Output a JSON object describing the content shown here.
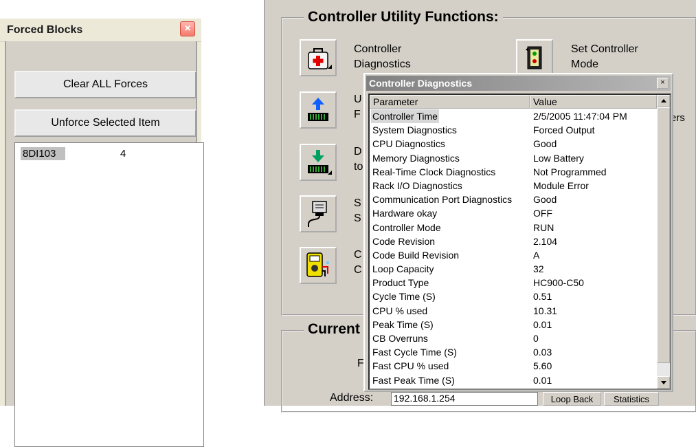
{
  "forced_blocks": {
    "title": "Forced Blocks",
    "close_glyph": "×",
    "clear_all_label": "Clear ALL Forces",
    "unforce_label": "Unforce Selected Item",
    "items": [
      {
        "name": "8DI103",
        "value": "4"
      }
    ]
  },
  "controller_utility": {
    "title": "Controller Utility Functions:",
    "buttons": [
      {
        "icon": "medical-bag-icon",
        "label_line1": "Controller",
        "label_line2": "Diagnostics"
      },
      {
        "icon": "set-mode-icon",
        "label_line1": "Set Controller",
        "label_line2": "Mode"
      },
      {
        "icon": "upload-icon",
        "label_line1": "U",
        "label_line2": "F"
      },
      {
        "icon": "download-icon",
        "label_line1": "D",
        "label_line2": "to"
      },
      {
        "icon": "serial-connection-icon",
        "label_line1": "S",
        "label_line2": "S"
      },
      {
        "icon": "meter-icon",
        "label_line1": "C",
        "label_line2": "C"
      }
    ],
    "partial_text_right": "ers"
  },
  "current_group": {
    "title": "Current",
    "partial_label": "F",
    "address_label": "Address:",
    "address_value": "192.168.1.254",
    "loop_back_label": "Loop Back",
    "statistics_label": "Statistics"
  },
  "diagnostics_dialog": {
    "title": "Controller Diagnostics",
    "close_glyph": "×",
    "columns": [
      "Parameter",
      "Value"
    ],
    "rows": [
      {
        "parameter": "Controller Time",
        "value": "2/5/2005  11:47:04 PM"
      },
      {
        "parameter": "System Diagnostics",
        "value": "Forced Output"
      },
      {
        "parameter": "CPU Diagnostics",
        "value": "Good"
      },
      {
        "parameter": "Memory Diagnostics",
        "value": "Low Battery"
      },
      {
        "parameter": "Real-Time Clock Diagnostics",
        "value": "Not Programmed"
      },
      {
        "parameter": "Rack I/O Diagnostics",
        "value": "Module Error"
      },
      {
        "parameter": "Communication Port Diagnostics",
        "value": "Good"
      },
      {
        "parameter": "Hardware okay",
        "value": "OFF"
      },
      {
        "parameter": "Controller Mode",
        "value": "RUN"
      },
      {
        "parameter": "Code Revision",
        "value": "2.104"
      },
      {
        "parameter": "Code Build Revision",
        "value": "A"
      },
      {
        "parameter": "Loop Capacity",
        "value": "32"
      },
      {
        "parameter": "Product Type",
        "value": "HC900-C50"
      },
      {
        "parameter": "Cycle Time (S)",
        "value": "0.51"
      },
      {
        "parameter": "CPU % used",
        "value": "10.31"
      },
      {
        "parameter": "Peak Time (S)",
        "value": "0.01"
      },
      {
        "parameter": "CB Overruns",
        "value": "0"
      },
      {
        "parameter": "Fast Cycle Time (S)",
        "value": "0.03"
      },
      {
        "parameter": "Fast CPU % used",
        "value": "5.60"
      },
      {
        "parameter": "Fast Peak Time (S)",
        "value": "0.01"
      }
    ]
  }
}
